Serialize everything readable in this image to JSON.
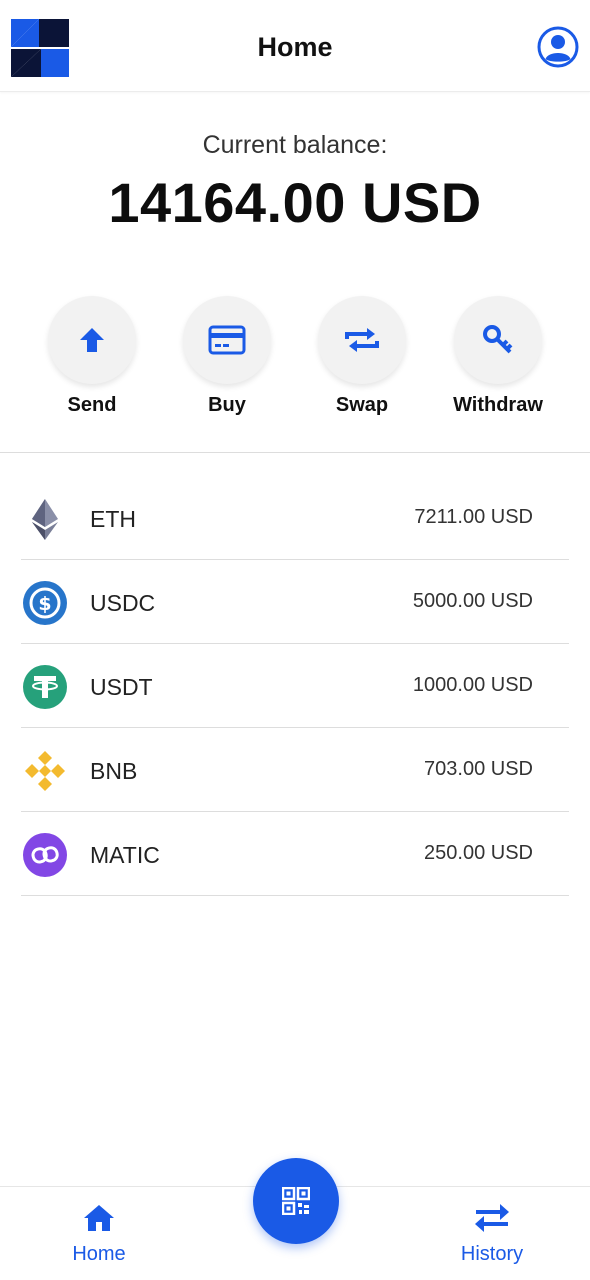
{
  "colors": {
    "accent": "#1a5ae6",
    "logo_dark": "#0b1437"
  },
  "header": {
    "title": "Home",
    "logo_icon": "app-logo",
    "profile_icon": "user-circle-icon"
  },
  "balance": {
    "label": "Current balance:",
    "value": "14164.00 USD"
  },
  "actions": [
    {
      "label": "Send",
      "icon": "arrow-up-icon"
    },
    {
      "label": "Buy",
      "icon": "credit-card-icon"
    },
    {
      "label": "Swap",
      "icon": "swap-arrows-icon"
    },
    {
      "label": "Withdraw",
      "icon": "key-icon"
    }
  ],
  "assets": [
    {
      "name": "ETH",
      "value": "7211.00 USD",
      "icon": "ethereum-icon"
    },
    {
      "name": "USDC",
      "value": "5000.00 USD",
      "icon": "usdc-icon"
    },
    {
      "name": "USDT",
      "value": "1000.00 USD",
      "icon": "tether-icon"
    },
    {
      "name": "BNB",
      "value": "703.00 USD",
      "icon": "bnb-icon"
    },
    {
      "name": "MATIC",
      "value": "250.00 USD",
      "icon": "polygon-icon"
    }
  ],
  "nav": {
    "home_label": "Home",
    "history_label": "History",
    "scan_icon": "qr-code-icon"
  }
}
